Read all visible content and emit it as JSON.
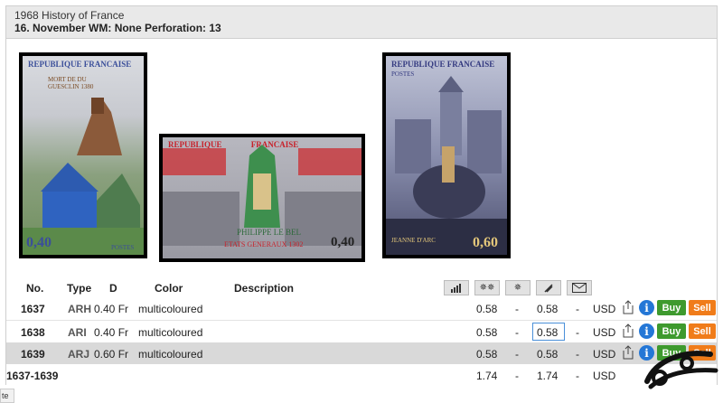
{
  "header": {
    "line1": "1968 History of France",
    "line2": "16. November WM: None  Perforation: 13"
  },
  "stamps": [
    {
      "country": "REPUBLIQUE FRANCAISE",
      "caption": "MORT DE DU GUESCLIN 1380",
      "value": "0,40",
      "footer": "POSTES"
    },
    {
      "country": "REPUBLIQUE FRANCAISE",
      "caption": "PHILIPPE LE BEL",
      "subcaption": "ETATS GENERAUX 1302",
      "value": "0,40"
    },
    {
      "country": "REPUBLIQUE FRANCAISE",
      "caption": "JEANNE D'ARC",
      "value": "0,60",
      "footer": "POSTES"
    }
  ],
  "table": {
    "headers": {
      "no": "No.",
      "type": "Type",
      "d": "D",
      "color": "Color",
      "description": "Description"
    },
    "rows": [
      {
        "no": "1637",
        "type": "ARH",
        "d": "0.40 Fr",
        "color": "multicoloured",
        "v1": "0.58",
        "dash1": "-",
        "v2": "0.58",
        "dash2": "-",
        "currency": "USD",
        "buy": "Buy",
        "sell": "Sell"
      },
      {
        "no": "1638",
        "type": "ARI",
        "d": "0.40 Fr",
        "color": "multicoloured",
        "v1": "0.58",
        "dash1": "-",
        "v2": "0.58",
        "dash2": "-",
        "currency": "USD",
        "buy": "Buy",
        "sell": "Sell"
      },
      {
        "no": "1639",
        "type": "ARJ",
        "d": "0.60 Fr",
        "color": "multicoloured",
        "v1": "0.58",
        "dash1": "-",
        "v2": "0.58",
        "dash2": "-",
        "currency": "USD",
        "buy": "Buy",
        "sell": "Sell"
      }
    ],
    "total": {
      "no": "1637-1639",
      "v1": "1.74",
      "dash1": "-",
      "v2": "1.74",
      "dash2": "-",
      "currency": "USD"
    }
  },
  "statusbar": {
    "text": "te"
  },
  "colors": {
    "buy": "#3e9a2e",
    "sell": "#f07c1a",
    "info": "#2477d6",
    "header_bg": "#e9e9e9",
    "row_alt": "#d9d9d9"
  }
}
